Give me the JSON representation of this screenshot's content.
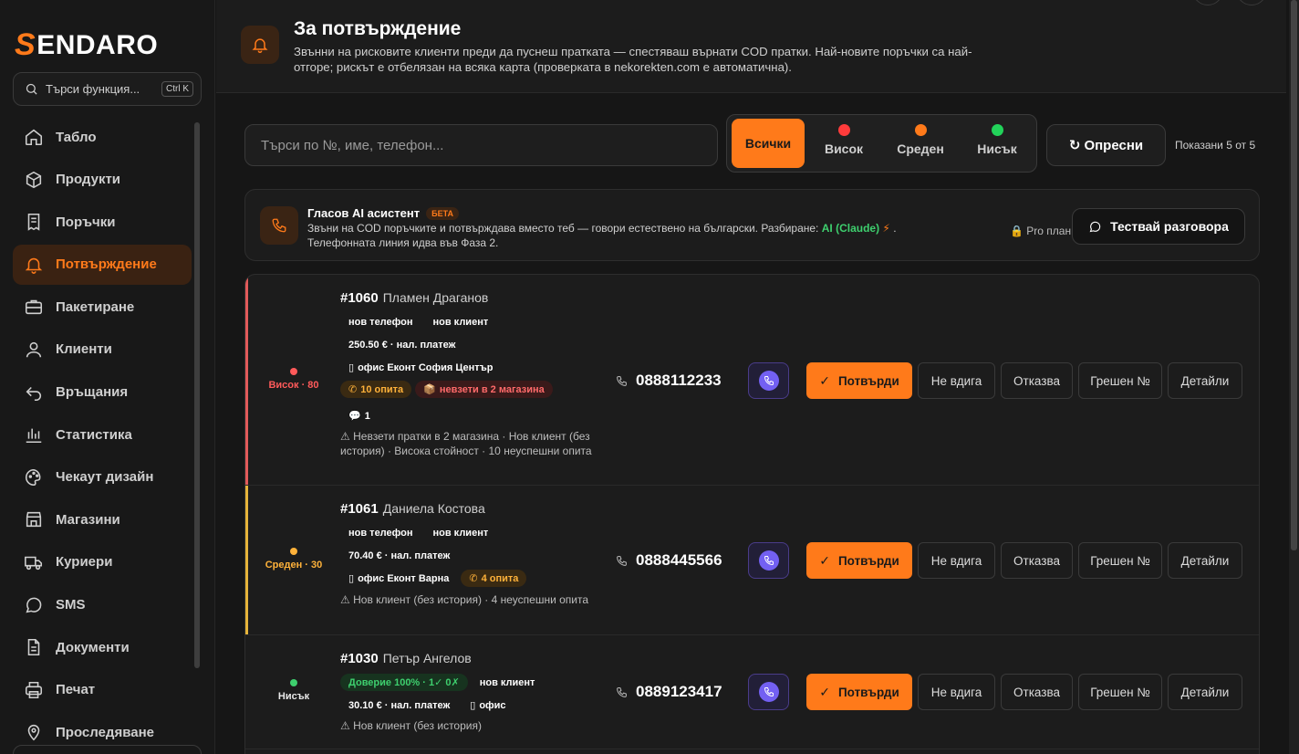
{
  "brand": {
    "logo_s": "S",
    "logo_rest": "ENDARO"
  },
  "sidebar": {
    "search_placeholder": "Търси функция...",
    "search_kbd": "Ctrl K",
    "items": [
      {
        "label": "Табло",
        "icon": "home-icon"
      },
      {
        "label": "Продукти",
        "icon": "box-icon"
      },
      {
        "label": "Поръчки",
        "icon": "receipt-icon"
      },
      {
        "label": "Потвърждение",
        "icon": "bell-icon",
        "active": true
      },
      {
        "label": "Пакетиране",
        "icon": "briefcase-icon"
      },
      {
        "label": "Клиенти",
        "icon": "user-icon"
      },
      {
        "label": "Връщания",
        "icon": "return-icon"
      },
      {
        "label": "Статистика",
        "icon": "bar-chart-icon"
      },
      {
        "label": "Чекаут дизайн",
        "icon": "palette-icon"
      },
      {
        "label": "Магазини",
        "icon": "store-icon"
      },
      {
        "label": "Куриери",
        "icon": "truck-icon"
      },
      {
        "label": "SMS",
        "icon": "message-icon"
      },
      {
        "label": "Документи",
        "icon": "document-icon"
      },
      {
        "label": "Печат",
        "icon": "printer-icon"
      },
      {
        "label": "Проследяване",
        "icon": "location-icon"
      }
    ]
  },
  "header": {
    "title": "За потвърждение",
    "description": "Звънни на рисковите клиенти преди да пуснеш пратката — спестяваш върнати COD пратки. Най-новите поръчки са най-отгоре; рискът е отбелязан на всяка карта (проверката в nekorekten.com е автоматична)."
  },
  "toolbar": {
    "search_placeholder": "Търси по №, име, телефон...",
    "filters": [
      {
        "label": "Всички",
        "color": null,
        "active": true
      },
      {
        "label": "Висок",
        "color": "#ff3b3b"
      },
      {
        "label": "Среден",
        "color": "#ff7a1a"
      },
      {
        "label": "Нисък",
        "color": "#22d35a"
      }
    ],
    "refresh_label": "Опресни",
    "shown_text": "Показани 5 от 5"
  },
  "ai_assistant": {
    "title": "Гласов AI асистент",
    "badge": "БЕТА",
    "desc_part1": "Звъни на COD поръчките и потвърждава вместо теб — говори естествено на български. Разбиране: ",
    "desc_ai": "AI (Claude)",
    "desc_part2": "Телефонната линия идва във Фаза 2.",
    "plan": "Pro план",
    "test_button": "Тествай разговора"
  },
  "actions": {
    "confirm": "Потвърди",
    "no_answer": "Не вдига",
    "refuse": "Отказва",
    "wrong": "Грешен №",
    "details": "Детайли"
  },
  "orders": [
    {
      "number": "#1060",
      "name": "Пламен Драганов",
      "risk_label": "Висок · 80",
      "risk_color": "#ff5a5a",
      "tags": [
        "нов телефон",
        "нов клиент"
      ],
      "amount": "250.50 € · нал. платеж",
      "office": "офис Еконт София Център",
      "attempts": "10 опита",
      "unpicked": "невзети в 2 магазина",
      "comments": "1",
      "warning": "Невзети пратки в 2 магазина · Нов клиент (без история) · Висока стойност · 10 неуспешни опита",
      "phone": "0888112233"
    },
    {
      "number": "#1061",
      "name": "Даниела Костова",
      "risk_label": "Среден · 30",
      "risk_color": "#ffb23a",
      "tags": [
        "нов телефон",
        "нов клиент"
      ],
      "amount": "70.40 € · нал. платеж",
      "office": "офис Еконт Варна",
      "attempts": "4 опита",
      "warning": "Нов клиент (без история) · 4 неуспешни опита",
      "phone": "0888445566"
    },
    {
      "number": "#1030",
      "name": "Петър Ангелов",
      "risk_label": "Нисък",
      "risk_color": "#3ecf6e",
      "trust": "Доверие 100% · 1✓ 0✗",
      "tags": [
        "нов клиент"
      ],
      "amount": "30.10 € · нал. платеж",
      "office": "офис",
      "warning": "Нов клиент (без история)",
      "phone": "0889123417"
    }
  ]
}
